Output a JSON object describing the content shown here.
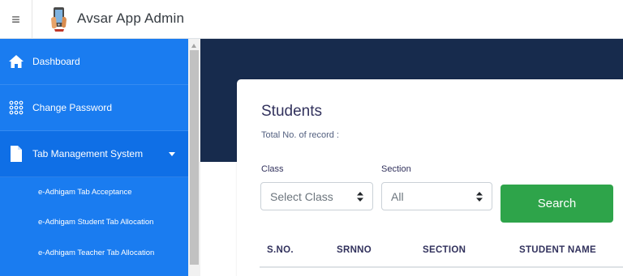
{
  "header": {
    "menu_icon": "hamburger-icon",
    "app_title": "Avsar App Admin",
    "logo_icon": "phone-logo-icon"
  },
  "sidebar": {
    "items": [
      {
        "label": "Dashboard",
        "icon": "home-icon"
      },
      {
        "label": "Change Password",
        "icon": "grid-dots-icon"
      },
      {
        "label": "Tab Management System",
        "icon": "file-icon",
        "expanded": true
      }
    ],
    "sub_items": [
      {
        "label": "e-Adhigam Tab Acceptance"
      },
      {
        "label": "e-Adhigam Student Tab Allocation"
      },
      {
        "label": "e-Adhigam Teacher Tab Allocation"
      }
    ]
  },
  "colors": {
    "sidebar": "#1a7cf0",
    "header_band": "#172b4d",
    "search_button": "#2ea44a"
  },
  "main": {
    "title": "Students",
    "record_label": "Total No. of record :",
    "class_label": "Class",
    "class_value": "Select Class",
    "section_label": "Section",
    "section_value": "All",
    "search_label": "Search",
    "table_headers": [
      "S.NO.",
      "SRNNO",
      "SECTION",
      "STUDENT NAME"
    ]
  }
}
